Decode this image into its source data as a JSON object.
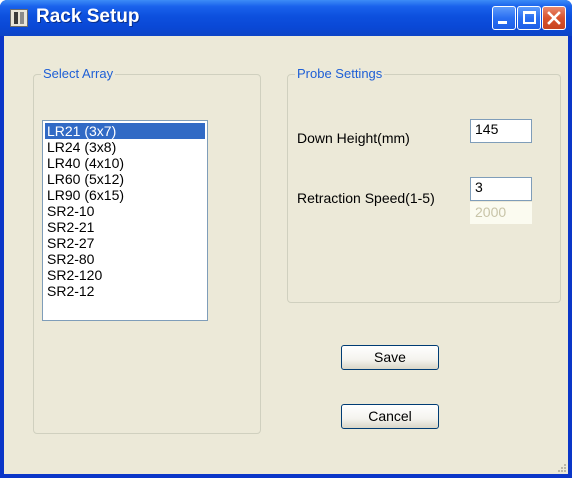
{
  "window": {
    "title": "Rack Setup"
  },
  "select_array": {
    "legend": "Select Array",
    "items": [
      "LR21 (3x7)",
      "LR24 (3x8)",
      "LR40 (4x10)",
      "LR60 (5x12)",
      "LR90 (6x15)",
      "SR2-10",
      "SR2-21",
      "SR2-27",
      "SR2-80",
      "SR2-120",
      "SR2-12"
    ],
    "selected_index": 0
  },
  "probe_settings": {
    "legend": "Probe Settings",
    "down_height_label": "Down Height(mm)",
    "down_height_value": "145",
    "retraction_speed_label": "Retraction Speed(1-5)",
    "retraction_speed_value": "3",
    "readonly_value": "2000"
  },
  "buttons": {
    "save_label": "Save",
    "cancel_label": "Cancel"
  },
  "colors": {
    "titlebar": "#0a48d6",
    "client_bg": "#ece9d8",
    "legend_text": "#1e5fd6",
    "selection": "#316ac5",
    "close_button": "#d9532d"
  }
}
